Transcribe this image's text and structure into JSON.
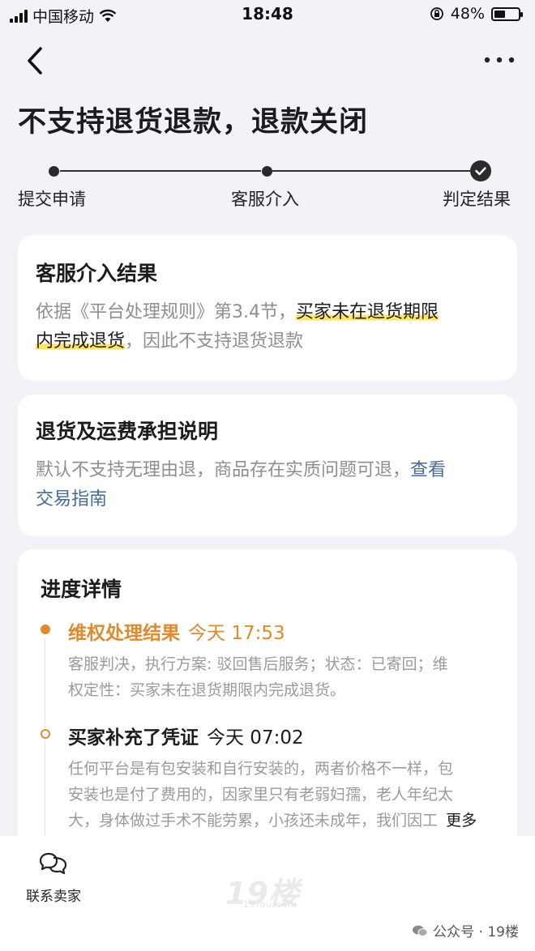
{
  "status_bar": {
    "carrier": "中国移动",
    "time": "18:48",
    "battery_text": "48%",
    "battery_level": 0.48
  },
  "page": {
    "title": "不支持退货退款，退款关闭"
  },
  "stepper": {
    "steps": [
      {
        "label": "提交申请"
      },
      {
        "label": "客服介入"
      },
      {
        "label": "判定结果"
      }
    ]
  },
  "result_card": {
    "title": "客服介入结果",
    "text_prefix": "依据《平台处理规则》第3.4节，",
    "text_highlight_1": "买家未在退货期限",
    "text_highlight_2": "内完成退货",
    "text_suffix": "，因此不支持退货退款"
  },
  "shipping_card": {
    "title": "退货及运费承担说明",
    "text": "默认不支持无理由退，商品存在实质问题可退，",
    "link_1": "查看",
    "link_2": "交易指南"
  },
  "progress": {
    "title": "进度详情",
    "items": [
      {
        "heading": "维权处理结果",
        "time": "今天 17:53",
        "line1": "客服判决，执行方案: 驳回售后服务；状态：已寄回；维",
        "line2": "权定性：买家未在退货期限内完成退货。"
      },
      {
        "heading": "买家补充了凭证",
        "time": "今天 07:02",
        "line1": "任何平台是有包安装和自行安装的，两者价格不一样，包",
        "line2": "安装也是付了费用的，因家里只有老弱妇孺，老人年纪太",
        "line3": "大，身体做过手术不能劳累，小孩还未成年，我们因工",
        "more": "更多"
      }
    ]
  },
  "bottom_bar": {
    "contact_label": "联系卖家",
    "watermark": "19楼",
    "watermark_sub": "19lou.com",
    "wechat_text": "公众号 · 19楼"
  },
  "colors": {
    "accent_orange": "#e08a2c",
    "highlight_yellow": "#ffe45c",
    "link_blue": "#466b93"
  }
}
